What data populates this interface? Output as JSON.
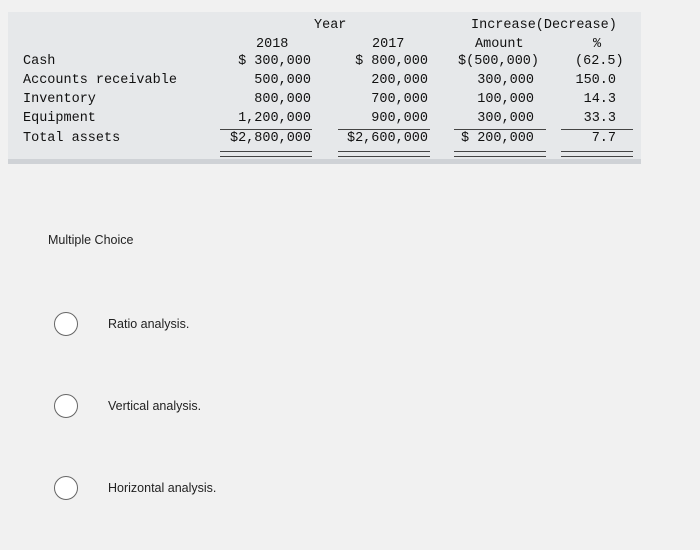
{
  "table": {
    "year_header": "Year",
    "change_header": "Increase(Decrease)",
    "col_2018": "2018",
    "col_2017": "2017",
    "col_amount": "Amount",
    "col_pct": "%",
    "rows": [
      {
        "label": "Cash",
        "v2018": "$ 300,000",
        "v2017": "$ 800,000",
        "amount": "$(500,000)",
        "pct": "(62.5)"
      },
      {
        "label": "Accounts receivable",
        "v2018": "500,000",
        "v2017": "200,000",
        "amount": "300,000",
        "pct": "150.0"
      },
      {
        "label": "Inventory",
        "v2018": "800,000",
        "v2017": "700,000",
        "amount": "100,000",
        "pct": "14.3"
      },
      {
        "label": "Equipment",
        "v2018": "1,200,000",
        "v2017": "900,000",
        "amount": "300,000",
        "pct": "33.3"
      },
      {
        "label": "Total assets",
        "v2018": "$2,800,000",
        "v2017": "$2,600,000",
        "amount": "$ 200,000",
        "pct": "7.7"
      }
    ]
  },
  "question": {
    "type_label": "Multiple Choice",
    "options": [
      {
        "label": "Ratio analysis."
      },
      {
        "label": "Vertical analysis."
      },
      {
        "label": "Horizontal analysis."
      }
    ]
  }
}
